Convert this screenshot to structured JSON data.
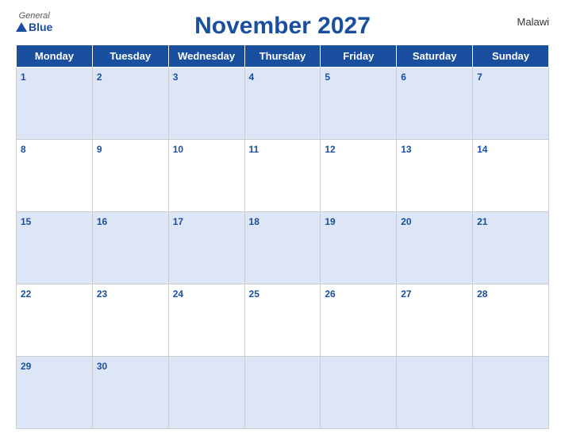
{
  "header": {
    "logo_general": "General",
    "logo_blue": "Blue",
    "title": "November 2027",
    "country": "Malawi"
  },
  "weekdays": [
    "Monday",
    "Tuesday",
    "Wednesday",
    "Thursday",
    "Friday",
    "Saturday",
    "Sunday"
  ],
  "weeks": [
    [
      1,
      2,
      3,
      4,
      5,
      6,
      7
    ],
    [
      8,
      9,
      10,
      11,
      12,
      13,
      14
    ],
    [
      15,
      16,
      17,
      18,
      19,
      20,
      21
    ],
    [
      22,
      23,
      24,
      25,
      26,
      27,
      28
    ],
    [
      29,
      30,
      null,
      null,
      null,
      null,
      null
    ]
  ]
}
